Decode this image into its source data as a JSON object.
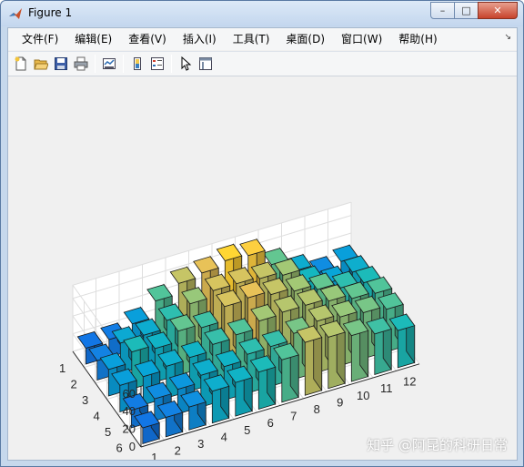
{
  "window": {
    "title": "Figure 1",
    "minimize_label": "–",
    "maximize_label": "□",
    "close_label": "✕"
  },
  "menu": [
    {
      "label": "文件(F)"
    },
    {
      "label": "编辑(E)"
    },
    {
      "label": "查看(V)"
    },
    {
      "label": "插入(I)"
    },
    {
      "label": "工具(T)"
    },
    {
      "label": "桌面(D)"
    },
    {
      "label": "窗口(W)"
    },
    {
      "label": "帮助(H)"
    }
  ],
  "toolbar": [
    {
      "icon": "new-figure-icon"
    },
    {
      "icon": "open-file-icon"
    },
    {
      "icon": "save-icon"
    },
    {
      "icon": "print-icon"
    },
    {
      "icon": "link-plot-icon"
    },
    {
      "icon": "insert-colorbar-icon"
    },
    {
      "icon": "insert-legend-icon"
    },
    {
      "icon": "edit-plot-icon"
    },
    {
      "icon": "property-inspector-icon"
    }
  ],
  "watermark": "知乎 @阿昆的科研日常",
  "chart_data": {
    "type": "bar3",
    "title": "",
    "xlabel": "",
    "ylabel": "",
    "zlabel": "",
    "rows": [
      "1",
      "2",
      "3",
      "4",
      "5",
      "6"
    ],
    "cols": [
      "1",
      "2",
      "3",
      "4",
      "5",
      "6",
      "7",
      "8",
      "9",
      "10",
      "11",
      "12"
    ],
    "z_ticks": [
      "0",
      "20",
      "40",
      "60"
    ],
    "zlim": [
      0,
      75
    ],
    "colormap": "parula",
    "values": [
      [
        18,
        20,
        30,
        48,
        60,
        64,
        70,
        68,
        50,
        35,
        25,
        30
      ],
      [
        22,
        34,
        35,
        44,
        55,
        62,
        62,
        60,
        56,
        40,
        32,
        36
      ],
      [
        30,
        42,
        38,
        50,
        46,
        62,
        64,
        60,
        56,
        50,
        44,
        42
      ],
      [
        30,
        32,
        36,
        38,
        45,
        48,
        56,
        58,
        58,
        55,
        50,
        48
      ],
      [
        20,
        25,
        28,
        36,
        38,
        44,
        45,
        52,
        58,
        55,
        52,
        48
      ],
      [
        18,
        22,
        26,
        36,
        38,
        42,
        48,
        60,
        58,
        52,
        46,
        42
      ]
    ]
  }
}
